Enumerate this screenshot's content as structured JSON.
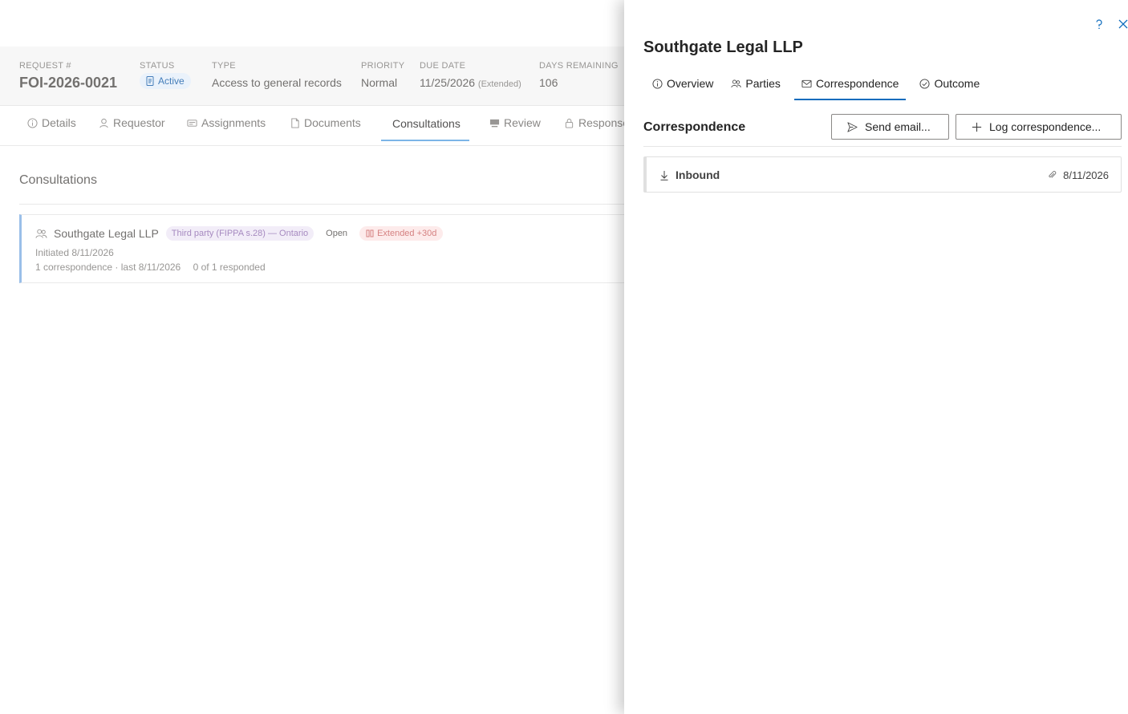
{
  "request": {
    "number_label": "REQUEST #",
    "number": "FOI-2026-0021",
    "status_label": "STATUS",
    "status": "Active",
    "type_label": "TYPE",
    "type": "Access to general records",
    "priority_label": "PRIORITY",
    "priority": "Normal",
    "due_label": "DUE DATE",
    "due_date": "11/25/2026",
    "due_note": "(Extended)",
    "days_label": "DAYS REMAINING",
    "days_remaining": "106"
  },
  "main_tabs": [
    {
      "label": "Details",
      "icon": "info-icon"
    },
    {
      "label": "Requestor",
      "icon": "person-icon"
    },
    {
      "label": "Assignments",
      "icon": "assignments-icon"
    },
    {
      "label": "Documents",
      "icon": "document-icon"
    },
    {
      "label": "Consultations",
      "icon": "none"
    },
    {
      "label": "Review",
      "icon": "review-icon"
    },
    {
      "label": "Response",
      "icon": "lock-icon"
    }
  ],
  "main_active_tab": "Consultations",
  "consultations": {
    "title": "Consultations",
    "card": {
      "org": "Southgate Legal LLP",
      "type_tag": "Third party (FIPPA s.28) — Ontario",
      "status": "Open",
      "extension": "Extended +30d",
      "initiated": "Initiated 8/11/2026",
      "summary": "1 correspondence · last 8/11/2026",
      "responded": "0 of 1 responded"
    }
  },
  "panel": {
    "title": "Southgate Legal LLP",
    "help_icon": "help-icon",
    "close_icon": "close-icon",
    "tabs": [
      {
        "label": "Overview",
        "icon": "info-icon"
      },
      {
        "label": "Parties",
        "icon": "people-icon"
      },
      {
        "label": "Correspondence",
        "icon": "mail-icon"
      },
      {
        "label": "Outcome",
        "icon": "check-circle-icon"
      }
    ],
    "active_tab": "Correspondence",
    "section_title": "Correspondence",
    "send_email_label": "Send email...",
    "log_label": "Log correspondence...",
    "items": [
      {
        "direction": "Inbound",
        "date": "8/11/2026",
        "has_attachment": true
      }
    ]
  },
  "colors": {
    "accent": "#0f6cbd",
    "status_bg": "#e8f1fb",
    "tag_purple_bg": "#f1ebf7",
    "tag_red_bg": "#fde9e9"
  }
}
